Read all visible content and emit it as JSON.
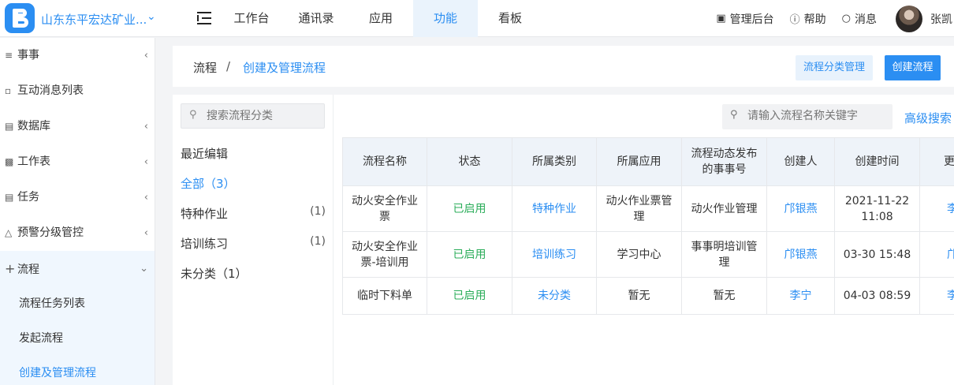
{
  "header": {
    "org_name": "山东东平宏达矿业...",
    "nav_tabs": [
      "工作台",
      "通讯录",
      "应用",
      "功能",
      "看板"
    ],
    "active_tab": "功能",
    "admin_label": "管理后台",
    "help_label": "帮助",
    "messages_label": "消息",
    "user_name": "张凯"
  },
  "sidebar": {
    "items": [
      {
        "label": "事事",
        "icon": "layers-icon"
      },
      {
        "label": "互动消息列表",
        "icon": "message-icon"
      },
      {
        "label": "数据库",
        "icon": "database-icon"
      },
      {
        "label": "工作表",
        "icon": "sheet-icon"
      },
      {
        "label": "任务",
        "icon": "task-icon"
      },
      {
        "label": "预警分级管控",
        "icon": "bell-icon"
      },
      {
        "label": "流程",
        "icon": "plus-icon"
      }
    ],
    "sub_items": [
      "流程任务列表",
      "发起流程",
      "创建及管理流程"
    ],
    "active_sub": "创建及管理流程"
  },
  "breadcrumb": {
    "root": "流程",
    "separator": "/",
    "current": "创建及管理流程"
  },
  "actions": {
    "category_manage": "流程分类管理",
    "create_flow": "创建流程"
  },
  "categories": {
    "search_placeholder": "搜索流程分类",
    "recent": "最近编辑",
    "all": "全部（3）",
    "items": [
      {
        "name": "特种作业",
        "count": "(1)"
      },
      {
        "name": "培训练习",
        "count": "(1)"
      }
    ],
    "uncategorized": "未分类（1）"
  },
  "search": {
    "placeholder": "请输入流程名称关键字",
    "advanced": "高级搜索"
  },
  "table": {
    "columns": [
      "流程名称",
      "状态",
      "所属类别",
      "所属应用",
      "流程动态发布的事事号",
      "创建人",
      "创建时间",
      "更"
    ],
    "rows": [
      {
        "name": "动火安全作业票",
        "status": "已启用",
        "category": "特种作业",
        "app": "动火作业票管理",
        "publish": "动火作业管理",
        "creator": "邝银燕",
        "created": "2021-11-22 11:08",
        "more": "李"
      },
      {
        "name": "动火安全作业票-培训用",
        "status": "已启用",
        "category": "培训练习",
        "app": "学习中心",
        "publish": "事事明培训管理",
        "creator": "邝银燕",
        "created": "03-30 15:48",
        "more": "邝"
      },
      {
        "name": "临时下料单",
        "status": "已启用",
        "category": "未分类",
        "app": "暂无",
        "publish": "暂无",
        "creator": "李宁",
        "created": "04-03 08:59",
        "more": "李"
      }
    ]
  },
  "colors": {
    "accent": "#2b8ef2",
    "enabled": "#2bad5a"
  }
}
